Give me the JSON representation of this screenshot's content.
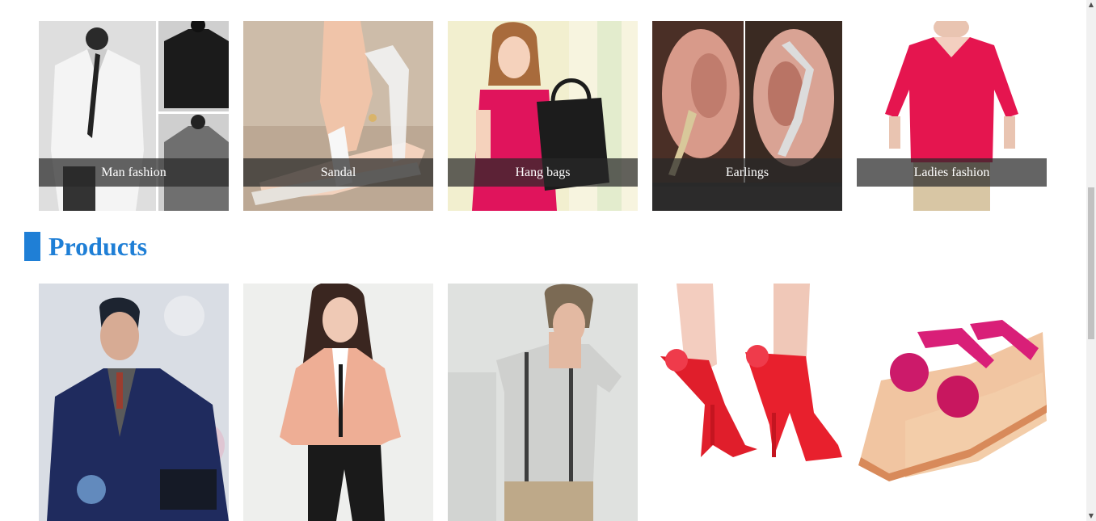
{
  "categories": [
    {
      "label": "Man fashion"
    },
    {
      "label": "Sandal"
    },
    {
      "label": "Hang bags"
    },
    {
      "label": "Earlings"
    },
    {
      "label": "Ladies fashion"
    }
  ],
  "products_section": {
    "title": "Products"
  },
  "products": [
    {
      "subject": "man in navy blazer"
    },
    {
      "subject": "woman in peach jacket"
    },
    {
      "subject": "man in grey t-shirt"
    },
    {
      "subject": "red high heels"
    },
    {
      "subject": "pink flower sandals"
    }
  ],
  "colors": {
    "accent": "#1f7fd6",
    "label_overlay": "#282828"
  },
  "scrollbar": {
    "up_icon": "arrow-up-icon",
    "down_icon": "arrow-down-icon"
  }
}
